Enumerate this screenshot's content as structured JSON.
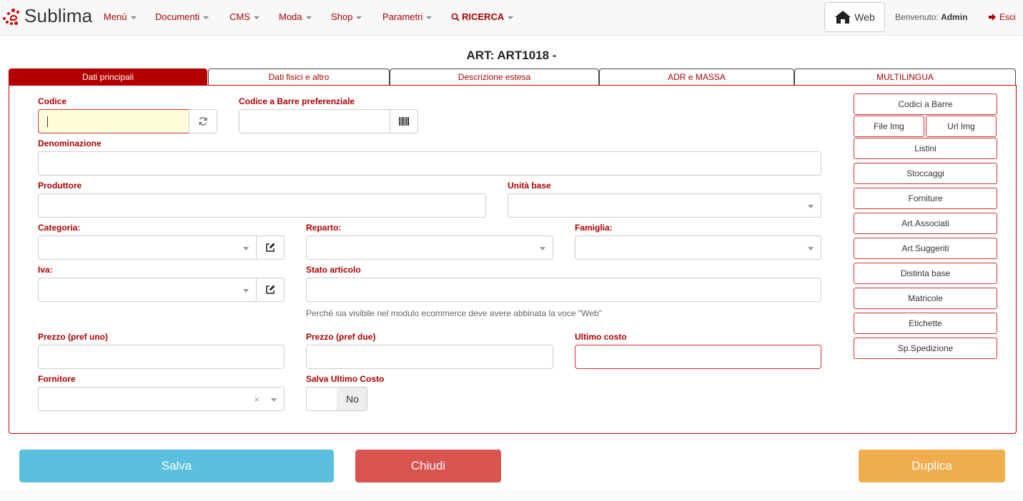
{
  "brand": {
    "name": "Sublima"
  },
  "nav": {
    "menu": "Menù",
    "documenti": "Documenti",
    "cms": "CMS",
    "moda": "Moda",
    "shop": "Shop",
    "parametri": "Parametri",
    "ricerca": "RICERCA"
  },
  "header": {
    "web_label": "Web",
    "welcome_prefix": "Benvenuto:",
    "welcome_user": "Admin",
    "logout": "Esci"
  },
  "page": {
    "title": "ART: ART1018 -"
  },
  "tabs": [
    {
      "label": "Dati principali",
      "active": true
    },
    {
      "label": "Dati fisici e altro"
    },
    {
      "label": "Descrizione estesa"
    },
    {
      "label": "ADR e MASSA"
    },
    {
      "label": "MULTILINGUA"
    }
  ],
  "form": {
    "codice": {
      "label": "Codice",
      "value": ""
    },
    "barcode": {
      "label": "Codice a Barre preferenziale",
      "value": ""
    },
    "denominazione": {
      "label": "Denominazione",
      "value": ""
    },
    "produttore": {
      "label": "Produttore",
      "value": ""
    },
    "unita_base": {
      "label": "Unità base",
      "value": ""
    },
    "categoria": {
      "label": "Categoria:",
      "value": ""
    },
    "reparto": {
      "label": "Reparto:",
      "value": ""
    },
    "famiglia": {
      "label": "Famiglia:",
      "value": ""
    },
    "iva": {
      "label": "Iva:",
      "value": ""
    },
    "stato_articolo": {
      "label": "Stato articolo",
      "value": "",
      "hint": "Perchè sia visibile nel modulo ecommerce deve avere abbinata la voce \"Web\""
    },
    "prezzo_uno": {
      "label": "Prezzo (pref uno)",
      "value": ""
    },
    "prezzo_due": {
      "label": "Prezzo (pref due)",
      "value": ""
    },
    "ultimo_costo": {
      "label": "Ultimo costo",
      "value": ""
    },
    "fornitore": {
      "label": "Fornitore",
      "value": ""
    },
    "salva_ultimo_costo": {
      "label": "Salva Ultimo Costo",
      "value": "No"
    }
  },
  "side_buttons": {
    "codici_barre": "Codici a Barre",
    "file_img": "File Img",
    "url_img": "Url Img",
    "listini": "Listini",
    "stoccaggi": "Stoccaggi",
    "forniture": "Forniture",
    "art_associati": "Art.Associati",
    "art_suggeriti": "Art.Suggeriti",
    "distinta_base": "Distinta base",
    "matricole": "Matricole",
    "etichette": "Etichette",
    "sp_spedizione": "Sp.Spedizione"
  },
  "actions": {
    "salva": "Salva",
    "chiudi": "Chiudi",
    "duplica": "Duplica"
  },
  "colors": {
    "accent": "#b30000",
    "info": "#5bc0de",
    "danger": "#d9534f",
    "warning": "#f0ad4e"
  }
}
